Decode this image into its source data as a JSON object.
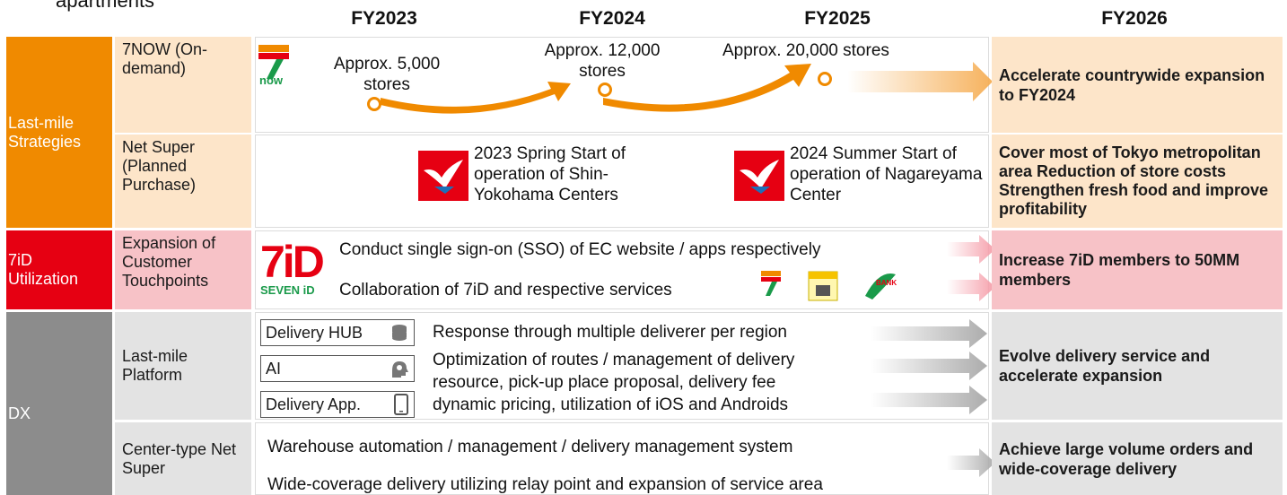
{
  "header": {
    "top_fragment": "apartments",
    "years": [
      "FY2023",
      "FY2024",
      "FY2025",
      "FY2026"
    ]
  },
  "colors": {
    "orange": "#f08a00",
    "red": "#e60012",
    "gray": "#8c8c8c",
    "peach": "#fde5c9",
    "pink": "#f7c2c7",
    "light_gray": "#e3e3e3"
  },
  "sections": {
    "lastmile": {
      "category": "Last-mile Strategies",
      "now": {
        "label": "7NOW (On-demand)",
        "milestones": [
          "Approx. 5,000 stores",
          "Approx. 12,000 stores",
          "Approx. 20,000 stores"
        ],
        "goal": "Accelerate countrywide expansion to FY2024",
        "logo_text": "now"
      },
      "netsuper": {
        "label": "Net Super (Planned Purchase)",
        "events": [
          "2023 Spring Start of operation of Shin-Yokohama Centers",
          "2024 Summer Start of operation of Nagareyama Center"
        ],
        "goal": "Cover most of Tokyo metropolitan area Reduction of store costs Strengthen fresh food and improve profitability"
      }
    },
    "seveniD": {
      "category": "7iD Utilization",
      "label": "Expansion of Customer Touchpoints",
      "logo_text": "SEVEN iD",
      "logo_mark": "7iD",
      "lines": [
        "Conduct single sign-on (SSO) of EC website / apps respectively",
        "Collaboration of 7iD and respective services"
      ],
      "goal": "Increase 7iD members to 50MM members",
      "service_icons": [
        "7now-icon",
        "seven-meal-icon",
        "seven-bank-icon"
      ]
    },
    "dx": {
      "category": "DX",
      "platform": {
        "label": "Last-mile Platform",
        "boxes": [
          "Delivery HUB",
          "AI",
          "Delivery App."
        ],
        "lines": [
          "Response through multiple deliverer per region",
          "Optimization of routes / management of delivery",
          "resource, pick-up place proposal, delivery fee",
          "dynamic pricing, utilization of iOS and Androids"
        ],
        "goal": "Evolve delivery service and accelerate expansion"
      },
      "center": {
        "label": "Center-type Net Super",
        "lines": [
          "Warehouse automation / management / delivery management system",
          "Wide-coverage delivery utilizing relay point and expansion of service area"
        ],
        "goal": "Achieve large volume orders and wide-coverage delivery"
      }
    }
  }
}
